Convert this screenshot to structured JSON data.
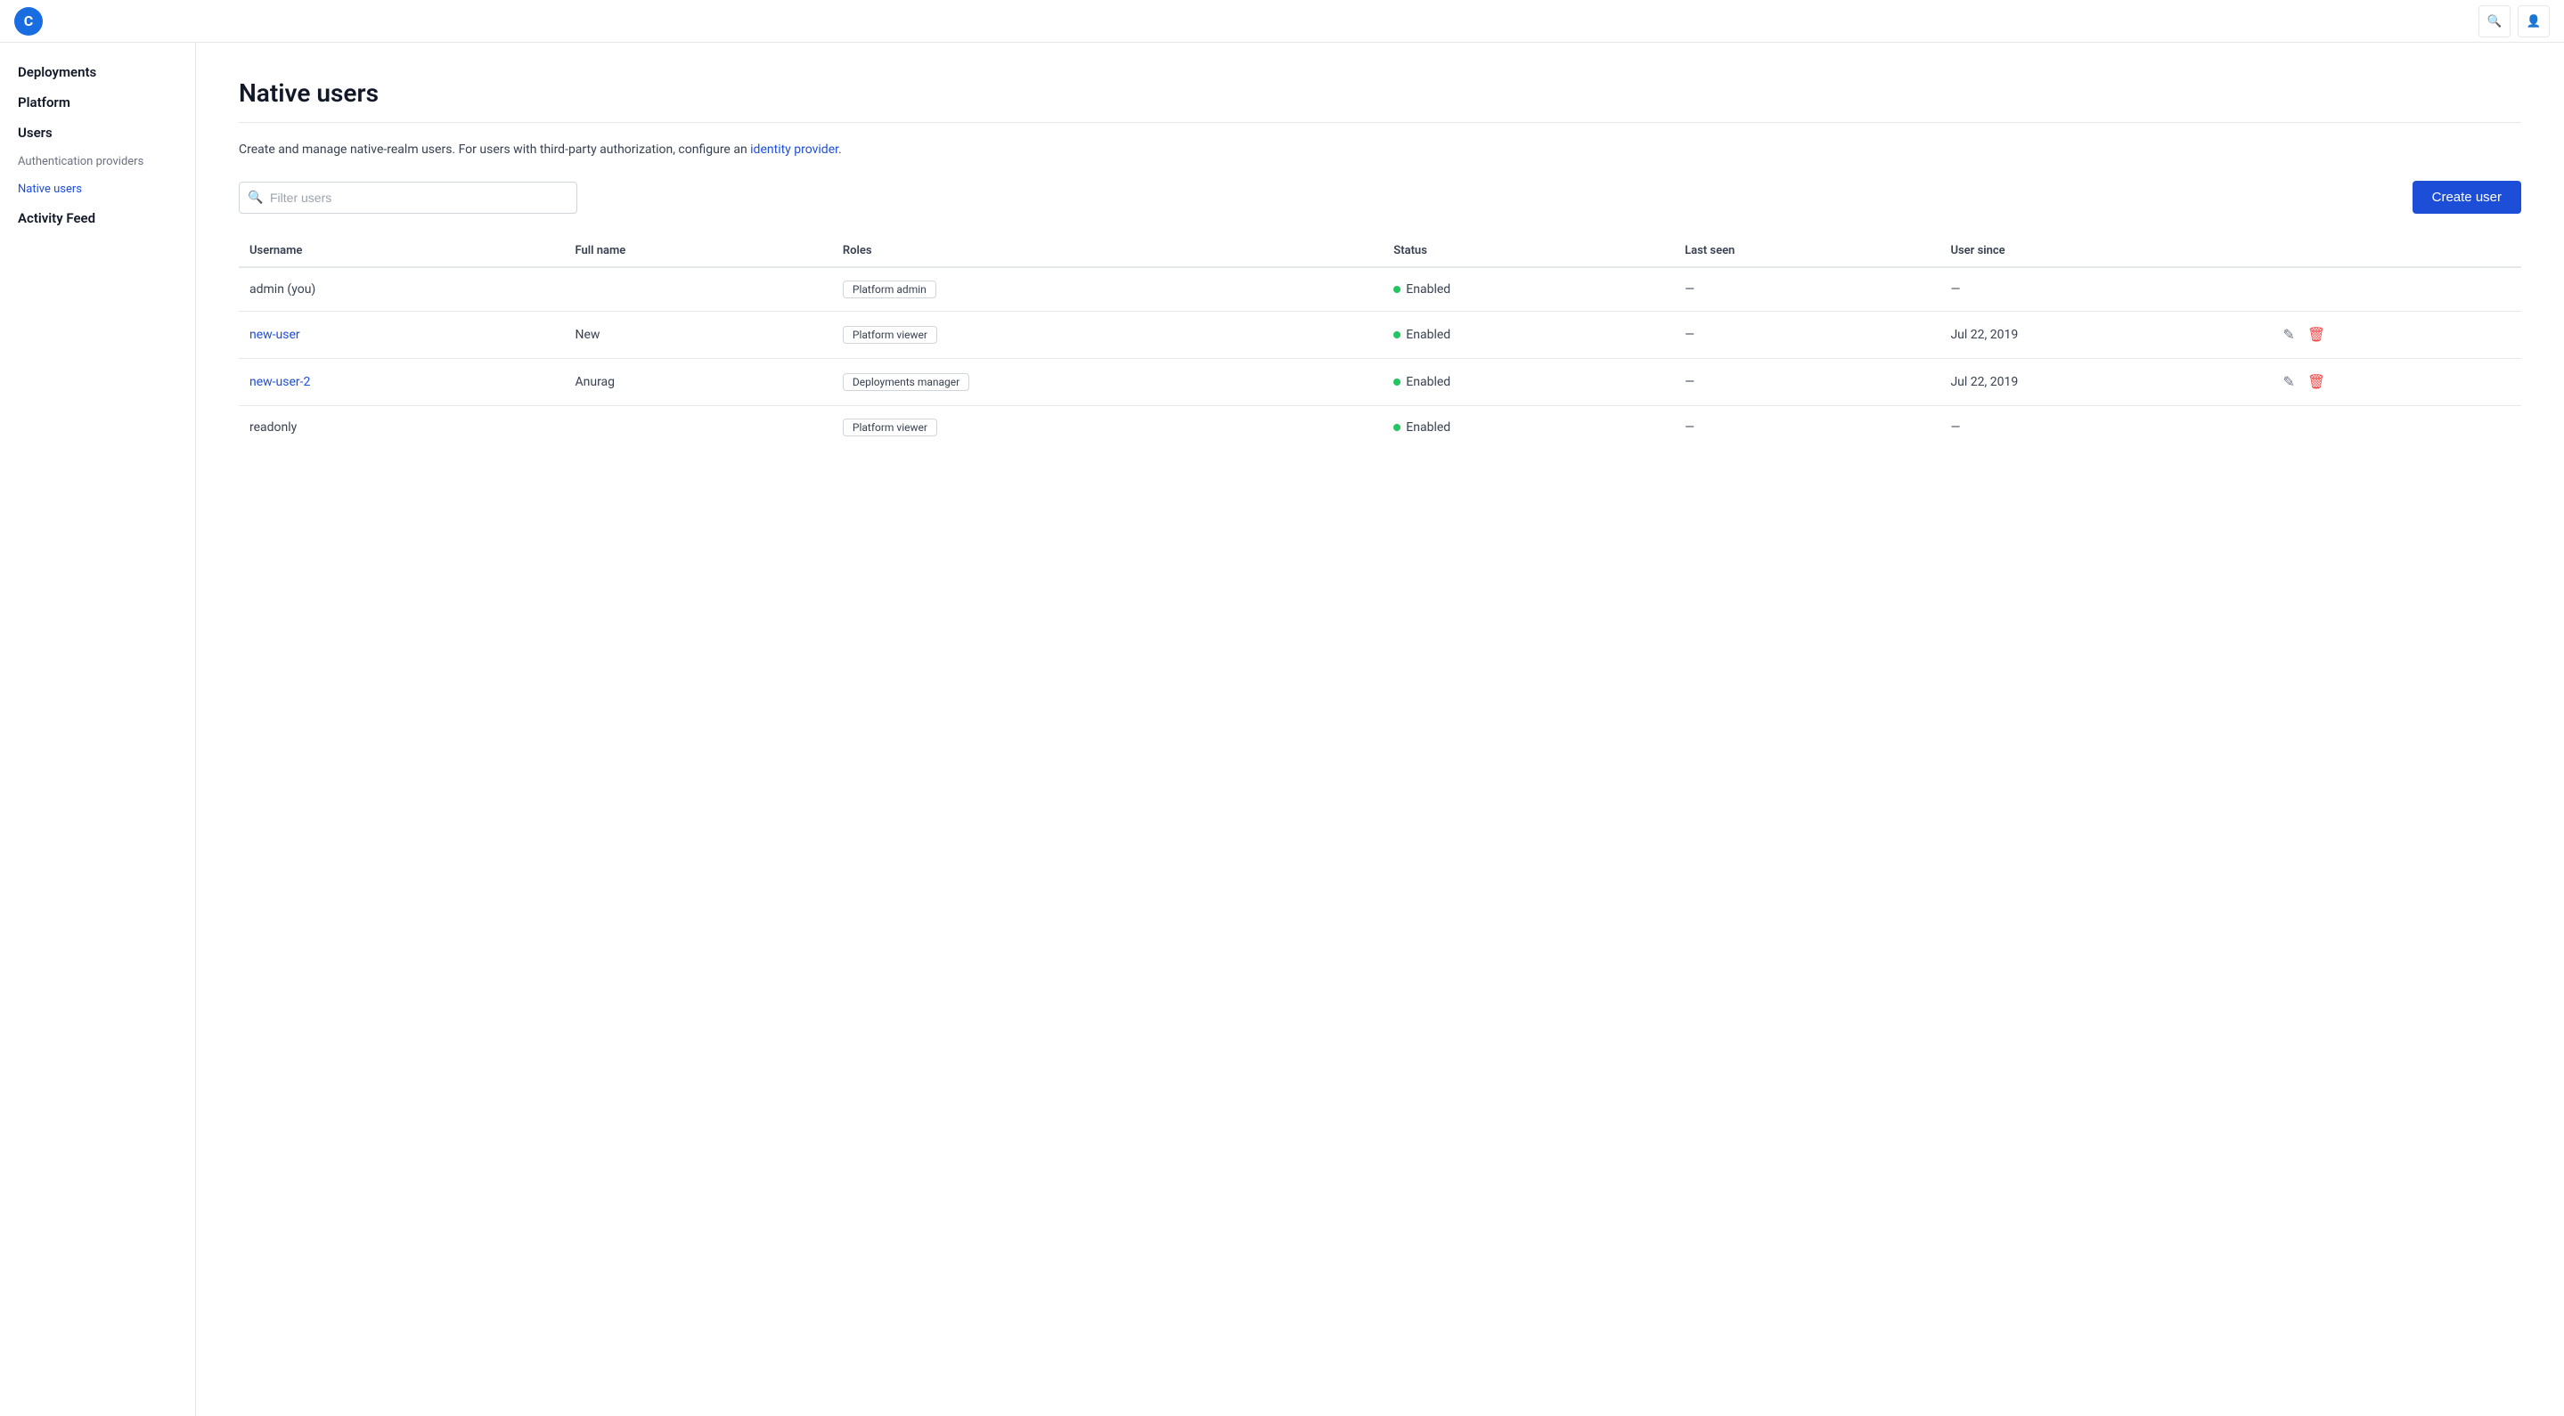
{
  "topBar": {
    "logoSymbol": "C",
    "searchTitle": "Search",
    "userTitle": "User"
  },
  "sidebar": {
    "items": [
      {
        "id": "deployments",
        "label": "Deployments",
        "type": "section",
        "indent": false
      },
      {
        "id": "platform",
        "label": "Platform",
        "type": "section",
        "indent": false
      },
      {
        "id": "users",
        "label": "Users",
        "type": "section",
        "indent": false
      },
      {
        "id": "auth-providers",
        "label": "Authentication providers",
        "type": "sub",
        "indent": true
      },
      {
        "id": "native-users",
        "label": "Native users",
        "type": "active",
        "indent": true
      },
      {
        "id": "activity-feed",
        "label": "Activity Feed",
        "type": "section",
        "indent": false
      }
    ]
  },
  "page": {
    "title": "Native users",
    "description": "Create and manage native-realm users. For users with third-party authorization, configure an",
    "identityProviderLink": "identity provider",
    "identityProviderLinkSuffix": "."
  },
  "filter": {
    "placeholder": "Filter users"
  },
  "buttons": {
    "createUser": "Create user"
  },
  "table": {
    "columns": [
      "Username",
      "Full name",
      "Roles",
      "Status",
      "Last seen",
      "User since"
    ],
    "rows": [
      {
        "username": "admin (you)",
        "usernameLink": false,
        "fullName": "",
        "role": "Platform admin",
        "status": "Enabled",
        "lastSeen": "—",
        "userSince": "—",
        "hasActions": false
      },
      {
        "username": "new-user",
        "usernameLink": true,
        "fullName": "New",
        "role": "Platform viewer",
        "status": "Enabled",
        "lastSeen": "—",
        "userSince": "Jul 22, 2019",
        "hasActions": true
      },
      {
        "username": "new-user-2",
        "usernameLink": true,
        "fullName": "Anurag",
        "role": "Deployments manager",
        "status": "Enabled",
        "lastSeen": "—",
        "userSince": "Jul 22, 2019",
        "hasActions": true
      },
      {
        "username": "readonly",
        "usernameLink": false,
        "fullName": "",
        "role": "Platform viewer",
        "status": "Enabled",
        "lastSeen": "—",
        "userSince": "—",
        "hasActions": false
      }
    ]
  }
}
